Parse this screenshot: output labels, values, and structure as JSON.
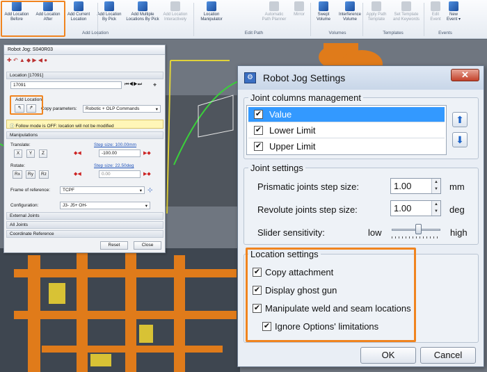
{
  "ribbon": {
    "buttons": [
      {
        "label1": "Add Location",
        "label2": "Before",
        "icon": "add-location-before-icon",
        "enabled": true
      },
      {
        "label1": "Add Location",
        "label2": "After",
        "icon": "add-location-after-icon",
        "enabled": true
      },
      {
        "label1": "Add Current",
        "label2": "Location",
        "icon": "add-current-location-icon",
        "enabled": true
      },
      {
        "label1": "Add Location",
        "label2": "By Pick",
        "icon": "add-location-by-pick-icon",
        "enabled": true
      },
      {
        "label1": "Add Multiple",
        "label2": "Locations By Pick",
        "icon": "add-multiple-locations-icon",
        "enabled": true
      },
      {
        "label1": "Add Location",
        "label2": "Interactively",
        "icon": "add-location-interactively-icon",
        "enabled": false
      },
      {
        "label1": "Location",
        "label2": "Manipulator",
        "icon": "location-manipulator-icon",
        "enabled": true
      },
      {
        "label1": "Automatic",
        "label2": "Path Planner",
        "icon": "path-planner-icon",
        "enabled": false
      },
      {
        "label1": "Mirror",
        "label2": "",
        "icon": "mirror-icon",
        "enabled": false
      },
      {
        "label1": "Swept",
        "label2": "Volume",
        "icon": "swept-volume-icon",
        "enabled": true
      },
      {
        "label1": "Interference",
        "label2": "Volume",
        "icon": "interference-volume-icon",
        "enabled": true
      },
      {
        "label1": "Apply Path",
        "label2": "Template",
        "icon": "apply-template-icon",
        "enabled": false
      },
      {
        "label1": "Set Template",
        "label2": "and Keywords",
        "icon": "set-template-icon",
        "enabled": false
      },
      {
        "label1": "Edit",
        "label2": "Event",
        "icon": "edit-event-icon",
        "enabled": false
      },
      {
        "label1": "New",
        "label2": "Event ▾",
        "icon": "new-event-icon",
        "enabled": true
      }
    ],
    "groups": [
      "Add Location",
      "Edit Path",
      "Volumes",
      "Templates",
      "Events"
    ]
  },
  "jog_small": {
    "title": "Robot Jog: S040R03",
    "location_header": "Location [17091]",
    "location_value": "17091",
    "add_location_label": "Add Location",
    "copy_parameters_label": "Copy parameters:",
    "copy_parameters_value": "Robotic + OLP Commands",
    "follow_mode_text": "Follow mode is OFF: location will not be modified",
    "manipulations_label": "Manipulations",
    "translate_label": "Translate:",
    "translate_step": "Step size: 100.00mm",
    "translate_axes": [
      "X",
      "Y",
      "Z"
    ],
    "translate_value": "-100.00",
    "rotate_label": "Rotate:",
    "rotate_step": "Step size: 22.50deg",
    "rotate_axes": [
      "Rx",
      "Ry",
      "Rz"
    ],
    "rotate_value": "0.00",
    "frame_label": "Frame of reference:",
    "frame_value": "TCPF",
    "config_label": "Configuration:",
    "config_value": "J3- J5+ OH-",
    "sections": [
      "External Joints",
      "All Joints",
      "Coordinate Reference"
    ],
    "reset": "Reset",
    "close": "Close"
  },
  "dialog": {
    "title": "Robot Jog Settings",
    "close_glyph": "✕",
    "joint_columns": {
      "legend": "Joint columns management",
      "items": [
        {
          "label": "Value",
          "checked": true,
          "selected": true
        },
        {
          "label": "Lower Limit",
          "checked": true,
          "selected": false
        },
        {
          "label": "Upper Limit",
          "checked": true,
          "selected": false
        }
      ]
    },
    "joint_settings": {
      "legend": "Joint settings",
      "prismatic_label": "Prismatic joints step size:",
      "prismatic_value": "1.00",
      "prismatic_unit": "mm",
      "revolute_label": "Revolute joints step size:",
      "revolute_value": "1.00",
      "revolute_unit": "deg",
      "slider_label": "Slider sensitivity:",
      "slider_low": "low",
      "slider_high": "high",
      "slider_level": 0.55
    },
    "location_settings": {
      "legend": "Location settings",
      "copy_attachment": "Copy attachment",
      "display_ghost_gun": "Display ghost gun",
      "manipulate_weld": "Manipulate weld and seam locations",
      "ignore_options": "Ignore Options' limitations"
    },
    "ok": "OK",
    "cancel": "Cancel"
  },
  "colors": {
    "highlight": "#f0841f",
    "selection": "#3399ff",
    "robot": "#e07b1a"
  }
}
